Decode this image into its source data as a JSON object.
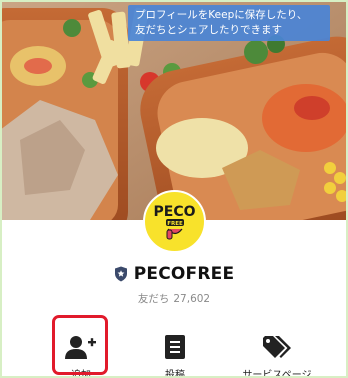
{
  "tooltip": {
    "line1": "プロフィールをKeepに保存したり、",
    "line2": "友だちとシェアしたりできます"
  },
  "profile": {
    "avatar_text_top": "PECO",
    "avatar_text_bottom": "FREE",
    "name": "PECOFREE",
    "friends_label": "友だち",
    "friends_count": "27,602"
  },
  "actions": [
    {
      "label": "追加",
      "icon": "add-friend-icon"
    },
    {
      "label": "投稿",
      "icon": "post-icon"
    },
    {
      "label": "サービスページ",
      "icon": "tag-icon"
    }
  ],
  "colors": {
    "highlight": "#e11a2b",
    "avatar_bg": "#f8e22b",
    "tooltip_bg": "#4a84d6",
    "badge_shield": "#3b4a6b"
  }
}
